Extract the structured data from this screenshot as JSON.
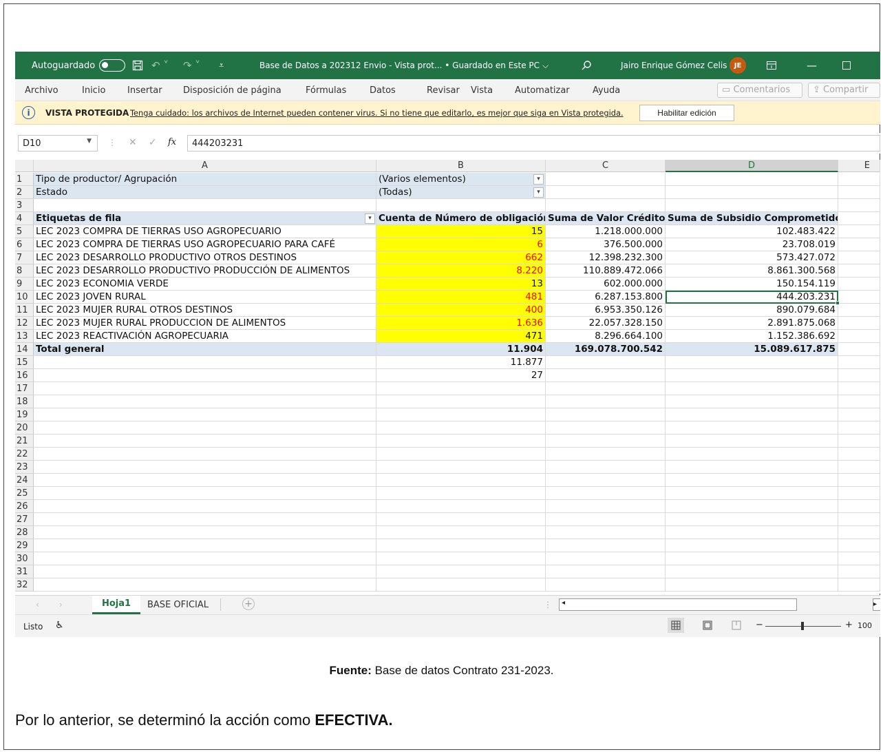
{
  "window": {
    "autosave_label": "Autoguardado",
    "title": "Base de Datos a 202312 Envio  -  Vista prot...  •  Guardado en Este PC",
    "user_name": "Jairo Enrique Gómez Celis",
    "user_initials": "JE"
  },
  "menu": {
    "items": [
      "Archivo",
      "Inicio",
      "Insertar",
      "Disposición de página",
      "Fórmulas",
      "Datos",
      "Revisar",
      "Vista",
      "Automatizar",
      "Ayuda"
    ],
    "comments": "Comentarios",
    "share": "Compartir"
  },
  "protected_view": {
    "title": "VISTA PROTEGIDA",
    "message": "Tenga cuidado: los archivos de Internet pueden contener virus. Si no tiene que editarlo, es mejor que siga en Vista protegida.",
    "button": "Habilitar edición"
  },
  "formula_bar": {
    "cell_ref": "D10",
    "fx_label": "fx",
    "value": "444203231"
  },
  "columns": [
    "A",
    "B",
    "C",
    "D",
    "E"
  ],
  "filters": [
    {
      "label": "Tipo de productor/ Agrupación",
      "value": "(Varios elementos)"
    },
    {
      "label": "Estado",
      "value": "(Todas)"
    }
  ],
  "pivot": {
    "headers": [
      "Etiquetas de fila",
      "Cuenta de Número de obligación",
      "Suma de Valor Crédito",
      "Suma de Subsidio Comprometido"
    ],
    "rows": [
      {
        "label": "LEC 2023 COMPRA DE TIERRAS USO AGROPECUARIO",
        "count": "15",
        "value": "1.218.000.000",
        "subsidy": "102.483.422",
        "red": false
      },
      {
        "label": "LEC 2023 COMPRA DE TIERRAS USO AGROPECUARIO PARA CAFÉ",
        "count": "6",
        "value": "376.500.000",
        "subsidy": "23.708.019",
        "red": true
      },
      {
        "label": "LEC 2023 DESARROLLO PRODUCTIVO OTROS DESTINOS",
        "count": "662",
        "value": "12.398.232.300",
        "subsidy": "573.427.072",
        "red": true
      },
      {
        "label": "LEC 2023 DESARROLLO PRODUCTIVO PRODUCCIÓN DE ALIMENTOS",
        "count": "8.220",
        "value": "110.889.472.066",
        "subsidy": "8.861.300.568",
        "red": true
      },
      {
        "label": "LEC 2023 ECONOMIA VERDE",
        "count": "13",
        "value": "602.000.000",
        "subsidy": "150.154.119",
        "red": false
      },
      {
        "label": "LEC 2023 JOVEN RURAL",
        "count": "481",
        "value": "6.287.153.800",
        "subsidy": "444.203.231",
        "red": true
      },
      {
        "label": "LEC 2023 MUJER RURAL OTROS DESTINOS",
        "count": "400",
        "value": "6.953.350.126",
        "subsidy": "890.079.684",
        "red": true
      },
      {
        "label": "LEC 2023 MUJER RURAL PRODUCCION DE ALIMENTOS",
        "count": "1.636",
        "value": "22.057.328.150",
        "subsidy": "2.891.875.068",
        "red": true
      },
      {
        "label": "LEC 2023 REACTIVACIÓN AGROPECUARIA",
        "count": "471",
        "value": "8.296.664.100",
        "subsidy": "1.152.386.692",
        "red": false
      }
    ],
    "total": {
      "label": "Total general",
      "count": "11.904",
      "value": "169.078.700.542",
      "subsidy": "15.089.617.875"
    },
    "extra": [
      "11.877",
      "27"
    ]
  },
  "sheets": {
    "active": "Hoja1",
    "other": "BASE OFICIAL"
  },
  "status": {
    "ready": "Listo",
    "zoom": "100"
  },
  "caption": {
    "bold": "Fuente:",
    "text": " Base de datos Contrato 231-2023."
  },
  "paragraph": {
    "text": "Por lo anterior, se determinó la acción como ",
    "bold": "EFECTIVA."
  }
}
